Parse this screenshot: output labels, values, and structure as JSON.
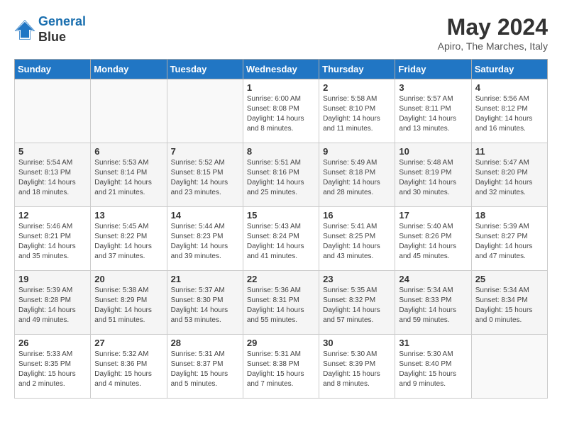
{
  "header": {
    "logo_line1": "General",
    "logo_line2": "Blue",
    "month_year": "May 2024",
    "location": "Apiro, The Marches, Italy"
  },
  "weekdays": [
    "Sunday",
    "Monday",
    "Tuesday",
    "Wednesday",
    "Thursday",
    "Friday",
    "Saturday"
  ],
  "weeks": [
    [
      {
        "day": "",
        "info": ""
      },
      {
        "day": "",
        "info": ""
      },
      {
        "day": "",
        "info": ""
      },
      {
        "day": "1",
        "info": "Sunrise: 6:00 AM\nSunset: 8:08 PM\nDaylight: 14 hours\nand 8 minutes."
      },
      {
        "day": "2",
        "info": "Sunrise: 5:58 AM\nSunset: 8:10 PM\nDaylight: 14 hours\nand 11 minutes."
      },
      {
        "day": "3",
        "info": "Sunrise: 5:57 AM\nSunset: 8:11 PM\nDaylight: 14 hours\nand 13 minutes."
      },
      {
        "day": "4",
        "info": "Sunrise: 5:56 AM\nSunset: 8:12 PM\nDaylight: 14 hours\nand 16 minutes."
      }
    ],
    [
      {
        "day": "5",
        "info": "Sunrise: 5:54 AM\nSunset: 8:13 PM\nDaylight: 14 hours\nand 18 minutes."
      },
      {
        "day": "6",
        "info": "Sunrise: 5:53 AM\nSunset: 8:14 PM\nDaylight: 14 hours\nand 21 minutes."
      },
      {
        "day": "7",
        "info": "Sunrise: 5:52 AM\nSunset: 8:15 PM\nDaylight: 14 hours\nand 23 minutes."
      },
      {
        "day": "8",
        "info": "Sunrise: 5:51 AM\nSunset: 8:16 PM\nDaylight: 14 hours\nand 25 minutes."
      },
      {
        "day": "9",
        "info": "Sunrise: 5:49 AM\nSunset: 8:18 PM\nDaylight: 14 hours\nand 28 minutes."
      },
      {
        "day": "10",
        "info": "Sunrise: 5:48 AM\nSunset: 8:19 PM\nDaylight: 14 hours\nand 30 minutes."
      },
      {
        "day": "11",
        "info": "Sunrise: 5:47 AM\nSunset: 8:20 PM\nDaylight: 14 hours\nand 32 minutes."
      }
    ],
    [
      {
        "day": "12",
        "info": "Sunrise: 5:46 AM\nSunset: 8:21 PM\nDaylight: 14 hours\nand 35 minutes."
      },
      {
        "day": "13",
        "info": "Sunrise: 5:45 AM\nSunset: 8:22 PM\nDaylight: 14 hours\nand 37 minutes."
      },
      {
        "day": "14",
        "info": "Sunrise: 5:44 AM\nSunset: 8:23 PM\nDaylight: 14 hours\nand 39 minutes."
      },
      {
        "day": "15",
        "info": "Sunrise: 5:43 AM\nSunset: 8:24 PM\nDaylight: 14 hours\nand 41 minutes."
      },
      {
        "day": "16",
        "info": "Sunrise: 5:41 AM\nSunset: 8:25 PM\nDaylight: 14 hours\nand 43 minutes."
      },
      {
        "day": "17",
        "info": "Sunrise: 5:40 AM\nSunset: 8:26 PM\nDaylight: 14 hours\nand 45 minutes."
      },
      {
        "day": "18",
        "info": "Sunrise: 5:39 AM\nSunset: 8:27 PM\nDaylight: 14 hours\nand 47 minutes."
      }
    ],
    [
      {
        "day": "19",
        "info": "Sunrise: 5:39 AM\nSunset: 8:28 PM\nDaylight: 14 hours\nand 49 minutes."
      },
      {
        "day": "20",
        "info": "Sunrise: 5:38 AM\nSunset: 8:29 PM\nDaylight: 14 hours\nand 51 minutes."
      },
      {
        "day": "21",
        "info": "Sunrise: 5:37 AM\nSunset: 8:30 PM\nDaylight: 14 hours\nand 53 minutes."
      },
      {
        "day": "22",
        "info": "Sunrise: 5:36 AM\nSunset: 8:31 PM\nDaylight: 14 hours\nand 55 minutes."
      },
      {
        "day": "23",
        "info": "Sunrise: 5:35 AM\nSunset: 8:32 PM\nDaylight: 14 hours\nand 57 minutes."
      },
      {
        "day": "24",
        "info": "Sunrise: 5:34 AM\nSunset: 8:33 PM\nDaylight: 14 hours\nand 59 minutes."
      },
      {
        "day": "25",
        "info": "Sunrise: 5:34 AM\nSunset: 8:34 PM\nDaylight: 15 hours\nand 0 minutes."
      }
    ],
    [
      {
        "day": "26",
        "info": "Sunrise: 5:33 AM\nSunset: 8:35 PM\nDaylight: 15 hours\nand 2 minutes."
      },
      {
        "day": "27",
        "info": "Sunrise: 5:32 AM\nSunset: 8:36 PM\nDaylight: 15 hours\nand 4 minutes."
      },
      {
        "day": "28",
        "info": "Sunrise: 5:31 AM\nSunset: 8:37 PM\nDaylight: 15 hours\nand 5 minutes."
      },
      {
        "day": "29",
        "info": "Sunrise: 5:31 AM\nSunset: 8:38 PM\nDaylight: 15 hours\nand 7 minutes."
      },
      {
        "day": "30",
        "info": "Sunrise: 5:30 AM\nSunset: 8:39 PM\nDaylight: 15 hours\nand 8 minutes."
      },
      {
        "day": "31",
        "info": "Sunrise: 5:30 AM\nSunset: 8:40 PM\nDaylight: 15 hours\nand 9 minutes."
      },
      {
        "day": "",
        "info": ""
      }
    ]
  ]
}
